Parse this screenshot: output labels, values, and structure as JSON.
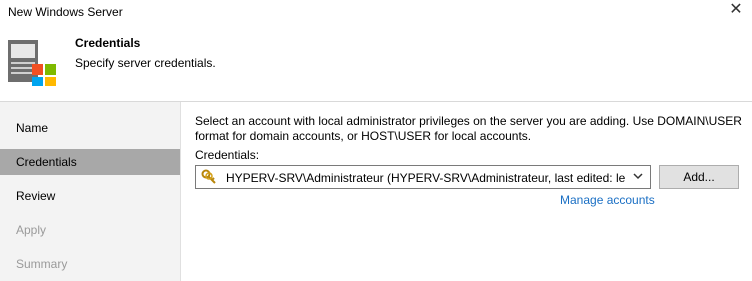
{
  "window": {
    "title": "New Windows Server",
    "close_glyph": "✕"
  },
  "header": {
    "title": "Credentials",
    "subtitle": "Specify server credentials.",
    "icon": "windows-server-icon"
  },
  "sidebar": {
    "items": [
      {
        "label": "Name",
        "state": "normal"
      },
      {
        "label": "Credentials",
        "state": "active"
      },
      {
        "label": "Review",
        "state": "normal"
      },
      {
        "label": "Apply",
        "state": "disabled"
      },
      {
        "label": "Summary",
        "state": "disabled"
      }
    ]
  },
  "main": {
    "description_line1": "Select an account with local administrator privileges on the server you are adding. Use DOMAIN\\USER",
    "description_line2": "format for domain accounts, or HOST\\USER for local accounts.",
    "credentials_label": "Credentials:",
    "credentials_value": "HYPERV-SRV\\Administrateur (HYPERV-SRV\\Administrateur, last edited: le...",
    "add_button": "Add...",
    "manage_link": "Manage accounts"
  },
  "colors": {
    "active_nav": "#a8a8a8",
    "link": "#1a6fc4",
    "sidebar_bg": "#f3f3f3"
  }
}
